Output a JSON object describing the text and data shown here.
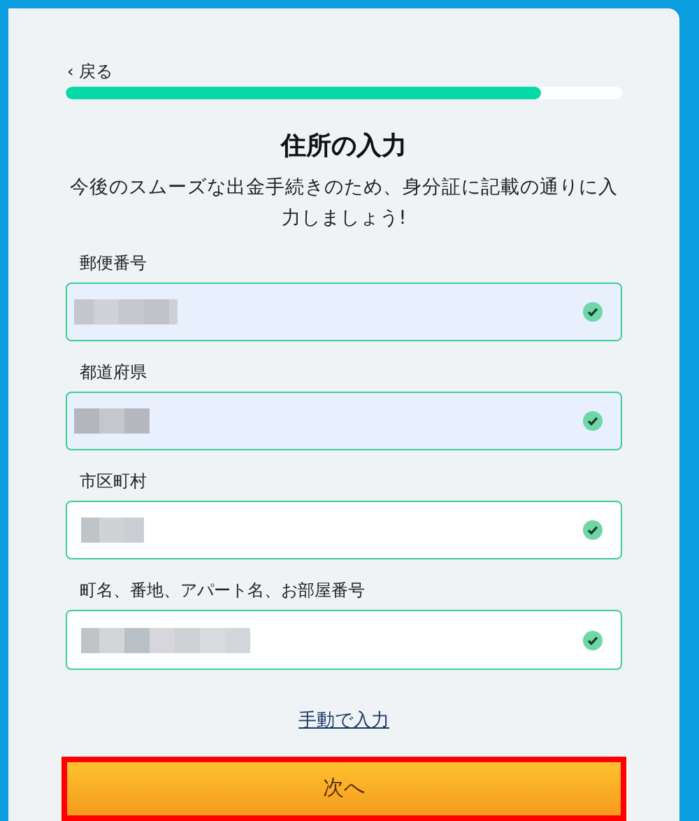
{
  "back_link": {
    "label": "‹ 戻る"
  },
  "progress": {
    "level": 0.855
  },
  "title": "住所の入力",
  "subtitle": "今後のスムーズな出金手続きのため、身分証に記載の通りに入力しましょう!",
  "fields": [
    {
      "label": "郵便番号",
      "autofilled": true,
      "valid": true
    },
    {
      "label": "都道府県",
      "autofilled": true,
      "valid": true
    },
    {
      "label": "市区町村",
      "autofilled": false,
      "valid": true
    },
    {
      "label": "町名、番地、アパート名、お部屋番号",
      "autofilled": false,
      "valid": true
    }
  ],
  "manual_link": "手動で入力",
  "next_button": {
    "label": "次へ",
    "highlighted": true
  }
}
